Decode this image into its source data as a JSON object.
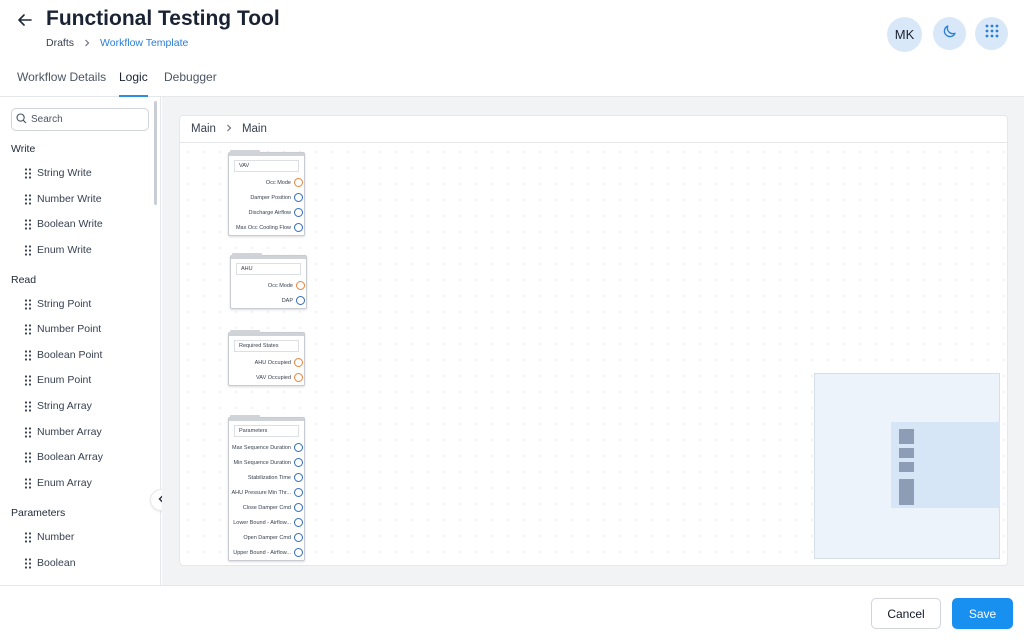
{
  "header": {
    "title": "Functional Testing Tool",
    "breadcrumb": {
      "parent": "Drafts",
      "current": "Workflow Template"
    },
    "avatar_initials": "MK",
    "icons": {
      "back": "arrow-left-icon",
      "theme": "moon-icon",
      "apps": "grid-dots-icon"
    }
  },
  "tabs": [
    {
      "label": "Workflow Details",
      "active": false
    },
    {
      "label": "Logic",
      "active": true
    },
    {
      "label": "Debugger",
      "active": false
    }
  ],
  "sidebar": {
    "search_placeholder": "Search",
    "sections": [
      {
        "title": "Write",
        "items": [
          "String Write",
          "Number Write",
          "Boolean Write",
          "Enum Write"
        ]
      },
      {
        "title": "Read",
        "items": [
          "String Point",
          "Number Point",
          "Boolean Point",
          "Enum Point",
          "String Array",
          "Number Array",
          "Boolean Array",
          "Enum Array"
        ]
      },
      {
        "title": "Parameters",
        "items": [
          "Number",
          "Boolean"
        ]
      }
    ]
  },
  "canvas": {
    "breadcrumb": [
      "Main",
      "Main"
    ],
    "nodes": [
      {
        "title": "VAV",
        "ports": [
          {
            "label": "Occ Mode",
            "color": "orange"
          },
          {
            "label": "Damper Position",
            "color": "blue"
          },
          {
            "label": "Discharge Airflow",
            "color": "blue"
          },
          {
            "label": "Max Occ Cooling Flow",
            "color": "blue"
          }
        ]
      },
      {
        "title": "AHU",
        "ports": [
          {
            "label": "Occ Mode",
            "color": "orange"
          },
          {
            "label": "DAP",
            "color": "blue"
          }
        ]
      },
      {
        "title": "Required States",
        "ports": [
          {
            "label": "AHU Occupied",
            "color": "orange"
          },
          {
            "label": "VAV Occupied",
            "color": "orange"
          }
        ]
      },
      {
        "title": "Parameters",
        "ports": [
          {
            "label": "Max Sequence Duration",
            "color": "blue"
          },
          {
            "label": "Min Sequence Duration",
            "color": "blue"
          },
          {
            "label": "Stabilization Time",
            "color": "blue"
          },
          {
            "label": "AHU Pressure Min Thr...",
            "color": "blue"
          },
          {
            "label": "Close Damper Cmd",
            "color": "blue"
          },
          {
            "label": "Lower Bound - Airflow...",
            "color": "blue"
          },
          {
            "label": "Open Damper Cmd",
            "color": "blue"
          },
          {
            "label": "Upper Bound - Airflow...",
            "color": "blue"
          }
        ]
      }
    ]
  },
  "footer": {
    "cancel_label": "Cancel",
    "save_label": "Save"
  },
  "colors": {
    "accent": "#1890f0",
    "link": "#2b7fd4",
    "port_orange": "#e8833a",
    "port_blue": "#2f6bbf"
  }
}
